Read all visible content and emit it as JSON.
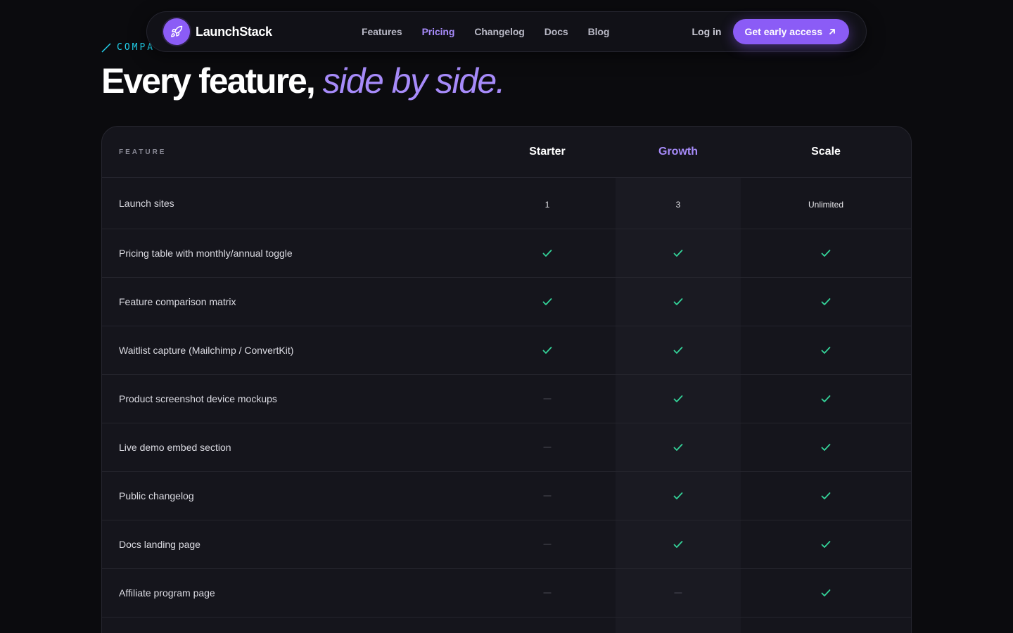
{
  "nav": {
    "brand": "LaunchStack",
    "brand_icon": "rocket-icon",
    "links": [
      "Features",
      "Pricing",
      "Changelog",
      "Docs",
      "Blog"
    ],
    "active_link": "Pricing",
    "login": "Log in",
    "cta": "Get early access",
    "cta_icon": "arrow-up-right-icon",
    "accent_color": "#8b5cf6"
  },
  "section": {
    "eyebrow": "COMPA",
    "heading_main": "Every feature, ",
    "heading_accent": "side by side."
  },
  "table": {
    "feature_header": "FEATURE",
    "plans": [
      "Starter",
      "Growth",
      "Scale"
    ],
    "highlighted_plan": "Growth",
    "rows": [
      {
        "feature": "Launch sites",
        "values": [
          "1",
          "3",
          "Unlimited"
        ]
      },
      {
        "feature": "Pricing table with monthly/annual toggle",
        "values": [
          "check",
          "check",
          "check"
        ]
      },
      {
        "feature": "Feature comparison matrix",
        "values": [
          "check",
          "check",
          "check"
        ]
      },
      {
        "feature": "Waitlist capture (Mailchimp / ConvertKit)",
        "values": [
          "check",
          "check",
          "check"
        ]
      },
      {
        "feature": "Product screenshot device mockups",
        "values": [
          "dash",
          "check",
          "check"
        ]
      },
      {
        "feature": "Live demo embed section",
        "values": [
          "dash",
          "check",
          "check"
        ]
      },
      {
        "feature": "Public changelog",
        "values": [
          "dash",
          "check",
          "check"
        ]
      },
      {
        "feature": "Docs landing page",
        "values": [
          "dash",
          "check",
          "check"
        ]
      },
      {
        "feature": "Affiliate program page",
        "values": [
          "dash",
          "dash",
          "check"
        ]
      }
    ],
    "check_color": "#34d399"
  }
}
